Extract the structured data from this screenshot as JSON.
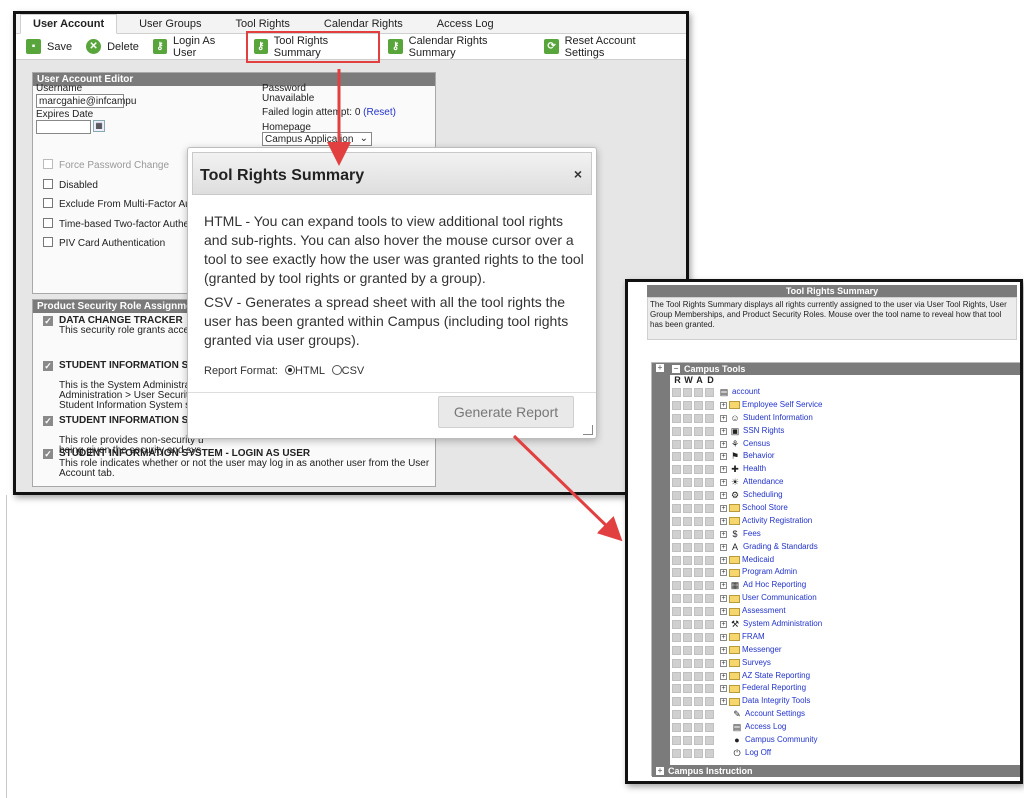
{
  "tabs": [
    "User Account",
    "User Groups",
    "Tool Rights",
    "Calendar Rights",
    "Access Log"
  ],
  "toolbar": {
    "save": "Save",
    "delete": "Delete",
    "login_as_user": "Login As User",
    "tool_rights_summary": "Tool Rights Summary",
    "calendar_rights_summary": "Calendar Rights Summary",
    "reset_account_settings": "Reset Account Settings"
  },
  "editor": {
    "title": "User Account Editor",
    "username_label": "Username",
    "username_value": "marcgahie@infcampu",
    "expires_label": "Expires Date",
    "password_label": "Password",
    "password_value": "Unavailable",
    "failed_login": "Failed login attempt: 0",
    "reset_link": "(Reset)",
    "homepage_label": "Homepage",
    "homepage_value": "Campus Application",
    "force_password": "Force Password Change",
    "disabled": "Disabled",
    "exclude_mfa": "Exclude From Multi-Factor Authe",
    "time_based": "Time-based Two-factor Authentic",
    "piv": "PIV Card Authentication"
  },
  "roles": {
    "title": "Product Security Role Assignments",
    "items": [
      {
        "name": "DATA CHANGE TRACKER",
        "desc": "This security role grants access"
      },
      {
        "name": "STUDENT INFORMATION SYST",
        "desc": "This is the System Administrator\nAdministration > User Security. T\nStudent Information System sec"
      },
      {
        "name": "STUDENT INFORMATION SYST",
        "desc": "This role provides non-security u\nbeing given the security and sys"
      },
      {
        "name": "STUDENT INFORMATION SYSTEM - LOGIN AS USER",
        "desc": "This role indicates whether or not the user may log in as another user from the User Account tab."
      }
    ]
  },
  "modal": {
    "title": "Tool Rights Summary",
    "close": "×",
    "html_label": "HTML -",
    "html_text": " You can expand tools to view additional tool rights and sub-rights. You can also hover the mouse cursor over a tool to see exactly how the user was granted rights to the tool (granted by tool rights or granted by a group).",
    "csv_label": "CSV -",
    "csv_text": " Generates a spread sheet with all the tool rights the user has been granted within Campus (including tool rights granted via user groups).",
    "report_format_label": "Report Format:",
    "opt_html": "HTML",
    "opt_csv": "CSV",
    "generate": "Generate Report"
  },
  "summary": {
    "title": "Tool Rights Summary",
    "desc": "The Tool Rights Summary displays all rights currently assigned to the user via User Tool Rights, User Group Memberships, and Product Security Roles. Mouse over the tool name to reveal how that tool has been granted.",
    "campus_tools": "Campus Tools",
    "campus_instruction": "Campus Instruction",
    "rwad": [
      "R",
      "W",
      "A",
      "D"
    ],
    "tools": [
      {
        "label": "account",
        "icon": "document-icon",
        "expand": false
      },
      {
        "label": "Employee Self Service",
        "icon": "folder-icon",
        "expand": true
      },
      {
        "label": "Student Information",
        "icon": "student-icon",
        "expand": true
      },
      {
        "label": "SSN Rights",
        "icon": "lock-icon",
        "expand": true
      },
      {
        "label": "Census",
        "icon": "census-icon",
        "expand": true
      },
      {
        "label": "Behavior",
        "icon": "behavior-icon",
        "expand": true
      },
      {
        "label": "Health",
        "icon": "health-icon",
        "expand": true
      },
      {
        "label": "Attendance",
        "icon": "attendance-icon",
        "expand": true
      },
      {
        "label": "Scheduling",
        "icon": "scheduling-icon",
        "expand": true
      },
      {
        "label": "School Store",
        "icon": "folder-icon",
        "expand": true
      },
      {
        "label": "Activity Registration",
        "icon": "folder-icon",
        "expand": true
      },
      {
        "label": "Fees",
        "icon": "dollar-icon",
        "expand": true
      },
      {
        "label": "Grading & Standards",
        "icon": "grading-icon",
        "expand": true
      },
      {
        "label": "Medicaid",
        "icon": "folder-icon",
        "expand": true
      },
      {
        "label": "Program Admin",
        "icon": "folder-icon",
        "expand": true
      },
      {
        "label": "Ad Hoc Reporting",
        "icon": "report-icon",
        "expand": true
      },
      {
        "label": "User Communication",
        "icon": "folder-icon",
        "expand": true
      },
      {
        "label": "Assessment",
        "icon": "folder-icon",
        "expand": true
      },
      {
        "label": "System Administration",
        "icon": "admin-icon",
        "expand": true
      },
      {
        "label": "FRAM",
        "icon": "folder-icon",
        "expand": true
      },
      {
        "label": "Messenger",
        "icon": "folder-icon",
        "expand": true
      },
      {
        "label": "Surveys",
        "icon": "folder-icon",
        "expand": true
      },
      {
        "label": "AZ State Reporting",
        "icon": "folder-icon",
        "expand": true
      },
      {
        "label": "Federal Reporting",
        "icon": "folder-icon",
        "expand": true
      },
      {
        "label": "Data Integrity Tools",
        "icon": "folder-icon",
        "expand": true
      },
      {
        "label": "Account Settings",
        "icon": "settings-doc-icon",
        "expand": false
      },
      {
        "label": "Access Log",
        "icon": "document-icon",
        "expand": false
      },
      {
        "label": "Campus Community",
        "icon": "community-icon",
        "expand": false
      },
      {
        "label": "Log Off",
        "icon": "logoff-icon",
        "expand": false
      }
    ]
  },
  "colors": {
    "accent_red": "#e24040",
    "toolbar_green": "#58a53c",
    "header_gray": "#7b7b7b",
    "link_blue": "#2233cc"
  }
}
